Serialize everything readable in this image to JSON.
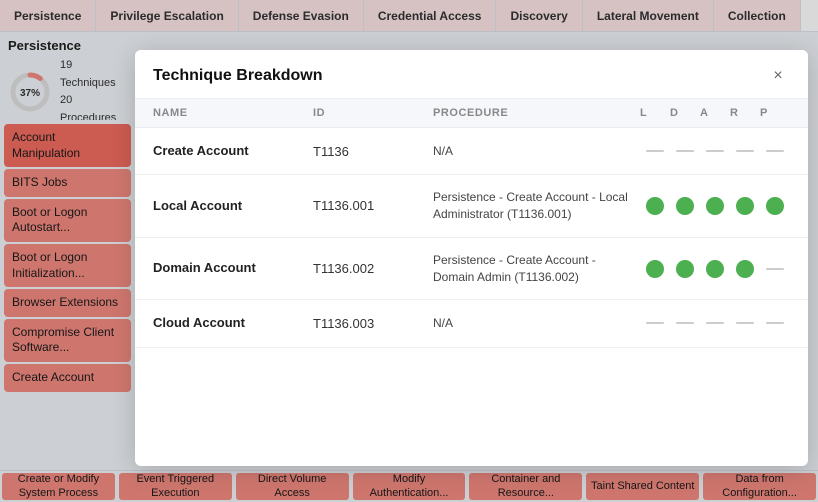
{
  "nav": {
    "items": [
      {
        "label": "Persistence",
        "id": "persistence"
      },
      {
        "label": "Privilege Escalation",
        "id": "privilege-escalation"
      },
      {
        "label": "Defense Evasion",
        "id": "defense-evasion"
      },
      {
        "label": "Credential Access",
        "id": "credential-access"
      },
      {
        "label": "Discovery",
        "id": "discovery"
      },
      {
        "label": "Lateral Movement",
        "id": "lateral-movement"
      },
      {
        "label": "Collection",
        "id": "collection"
      }
    ]
  },
  "persistence": {
    "title": "Persistence",
    "percent": "37%",
    "techniques_label": "Techniques",
    "techniques_count": 19,
    "procedures_label": "Procedures",
    "procedures_count": 20
  },
  "sidebar": {
    "items": [
      {
        "label": "Account Manipulation",
        "id": "account-manipulation"
      },
      {
        "label": "BITS Jobs",
        "id": "bits-jobs"
      },
      {
        "label": "Boot or Logon Autostart...",
        "id": "boot-logon-autostart"
      },
      {
        "label": "Boot or Logon Initialization...",
        "id": "boot-logon-init"
      },
      {
        "label": "Browser Extensions",
        "id": "browser-extensions"
      },
      {
        "label": "Compromise Client Software...",
        "id": "compromise-client"
      },
      {
        "label": "Create Account",
        "id": "create-account"
      }
    ]
  },
  "modal": {
    "title": "Technique Breakdown",
    "close_label": "×",
    "table": {
      "headers": [
        "NAME",
        "ID",
        "PROCEDURE",
        "L",
        "D",
        "A",
        "R",
        "P"
      ],
      "rows": [
        {
          "name": "Create Account",
          "id": "T1136",
          "procedure": "N/A",
          "indicators": [
            false,
            false,
            false,
            false,
            false
          ]
        },
        {
          "name": "Local Account",
          "id": "T1136.001",
          "procedure": "Persistence - Create Account - Local Administrator (T1136.001)",
          "indicators": [
            true,
            true,
            true,
            true,
            true
          ]
        },
        {
          "name": "Domain Account",
          "id": "T1136.002",
          "procedure": "Persistence - Create Account - Domain Admin (T1136.002)",
          "indicators": [
            true,
            true,
            true,
            true,
            false
          ]
        },
        {
          "name": "Cloud Account",
          "id": "T1136.003",
          "procedure": "N/A",
          "indicators": [
            false,
            false,
            false,
            false,
            false
          ]
        }
      ]
    }
  },
  "bottom_bar": {
    "items": [
      {
        "label": "Create or Modify System Process"
      },
      {
        "label": "Event Triggered Execution"
      },
      {
        "label": "Direct Volume Access"
      },
      {
        "label": "Modify Authentication..."
      },
      {
        "label": "Container and Resource..."
      },
      {
        "label": "Taint Shared Content"
      },
      {
        "label": "Data from Configuration..."
      }
    ]
  }
}
